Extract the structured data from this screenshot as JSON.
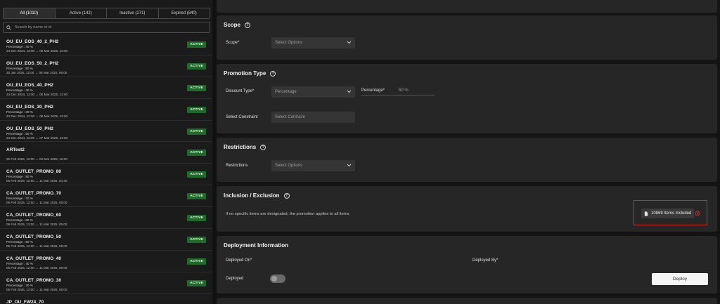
{
  "filters": {
    "tabs": [
      "All (1010)",
      "Active (142)",
      "Inactive (271)",
      "Expired (840)"
    ],
    "search_placeholder": "Search by name or id"
  },
  "promotions": [
    {
      "name": "OU_EU_EOS_40_2_PH2",
      "detail": "Percentage : 40 %",
      "dates": "24 Dec 2024, 12:00 → 06 Mar 2025, 12:00",
      "status": "ACTIVE"
    },
    {
      "name": "OU_EU_EOS_50_2_PH2",
      "detail": "Percentage : 50 %",
      "dates": "20 Jan 2025, 12:00 → 06 Mar 2025, 06:00",
      "status": "ACTIVE"
    },
    {
      "name": "OU_EU_EOS_40_PH2",
      "detail": "Percentage : 40 %",
      "dates": "24 Dec 2024, 12:00 → 06 Mar 2025, 12:00",
      "status": "ACTIVE"
    },
    {
      "name": "OU_EU_EOS_30_PH2",
      "detail": "Percentage : 30 %",
      "dates": "24 Dec 2024, 12:00 → 06 Mar 2025, 12:00",
      "status": "ACTIVE"
    },
    {
      "name": "OU_EU_EOS_50_PH2",
      "detail": "Percentage : 50 %",
      "dates": "24 Dec 2024, 12:00 → 07 Mar 2025, 12:00",
      "status": "ACTIVE"
    },
    {
      "name": "ARTest2",
      "detail": "",
      "dates": "26 Feb 2025, 12:00 → 03 Mar 2025, 12:00",
      "status": "ACTIVE"
    },
    {
      "name": "CA_OUTLET_PROMO_80",
      "detail": "Percentage : 80 %",
      "dates": "06 Feb 2025, 12:00 → 11 Mar 2025, 04:30",
      "status": "ACTIVE"
    },
    {
      "name": "CA_OUTLET_PROMO_70",
      "detail": "Percentage : 70 %",
      "dates": "06 Feb 2025, 12:00 → 11 Mar 2025, 05:00",
      "status": "ACTIVE"
    },
    {
      "name": "CA_OUTLET_PROMO_60",
      "detail": "Percentage : 60 %",
      "dates": "06 Feb 2025, 12:00 → 11 Mar 2025, 05:00",
      "status": "ACTIVE"
    },
    {
      "name": "CA_OUTLET_PROMO_50",
      "detail": "Percentage : 50 %",
      "dates": "06 Feb 2025, 12:00 → 11 Mar 2025, 05:00",
      "status": "ACTIVE"
    },
    {
      "name": "CA_OUTLET_PROMO_40",
      "detail": "Percentage : 40 %",
      "dates": "06 Feb 2025, 12:00 → 11 Mar 2025, 05:00",
      "status": "ACTIVE"
    },
    {
      "name": "CA_OUTLET_PROMO_30",
      "detail": "Percentage : 30 %",
      "dates": "06 Feb 2025, 12:00 → 11 Mar 2025, 05:00",
      "status": "ACTIVE"
    },
    {
      "name": "JP_OU_FW24_70",
      "detail": "",
      "dates": "",
      "status": ""
    }
  ],
  "scope": {
    "title": "Scope",
    "label": "Scope*",
    "placeholder": "Select Options"
  },
  "promotion_type": {
    "title": "Promotion Type",
    "discount_label": "Discount Type*",
    "discount_value": "Percentage",
    "percentage_label": "Percentage*",
    "percentage_value": "50 %",
    "constraint_label": "Select Constraint",
    "constraint_placeholder": "Select Contraint"
  },
  "restrictions": {
    "title": "Restrictions",
    "label": "Restrictions",
    "placeholder": "Select Options"
  },
  "inclusion": {
    "title": "Inclusion / Exclusion",
    "note": "If no specific items are designated, the promotion applies to all items",
    "items_button": "10869 Items Included"
  },
  "deployment": {
    "title": "Deployment Information",
    "deployed_on_label": "Deployed On*",
    "deployed_by_label": "Deployed By*",
    "deployed_label": "Deployed",
    "deployed_toggle": false,
    "deploy_button": "Deploy"
  },
  "colors": {
    "active_badge": "#1f6b2b",
    "highlight_border": "#d12b2b"
  }
}
